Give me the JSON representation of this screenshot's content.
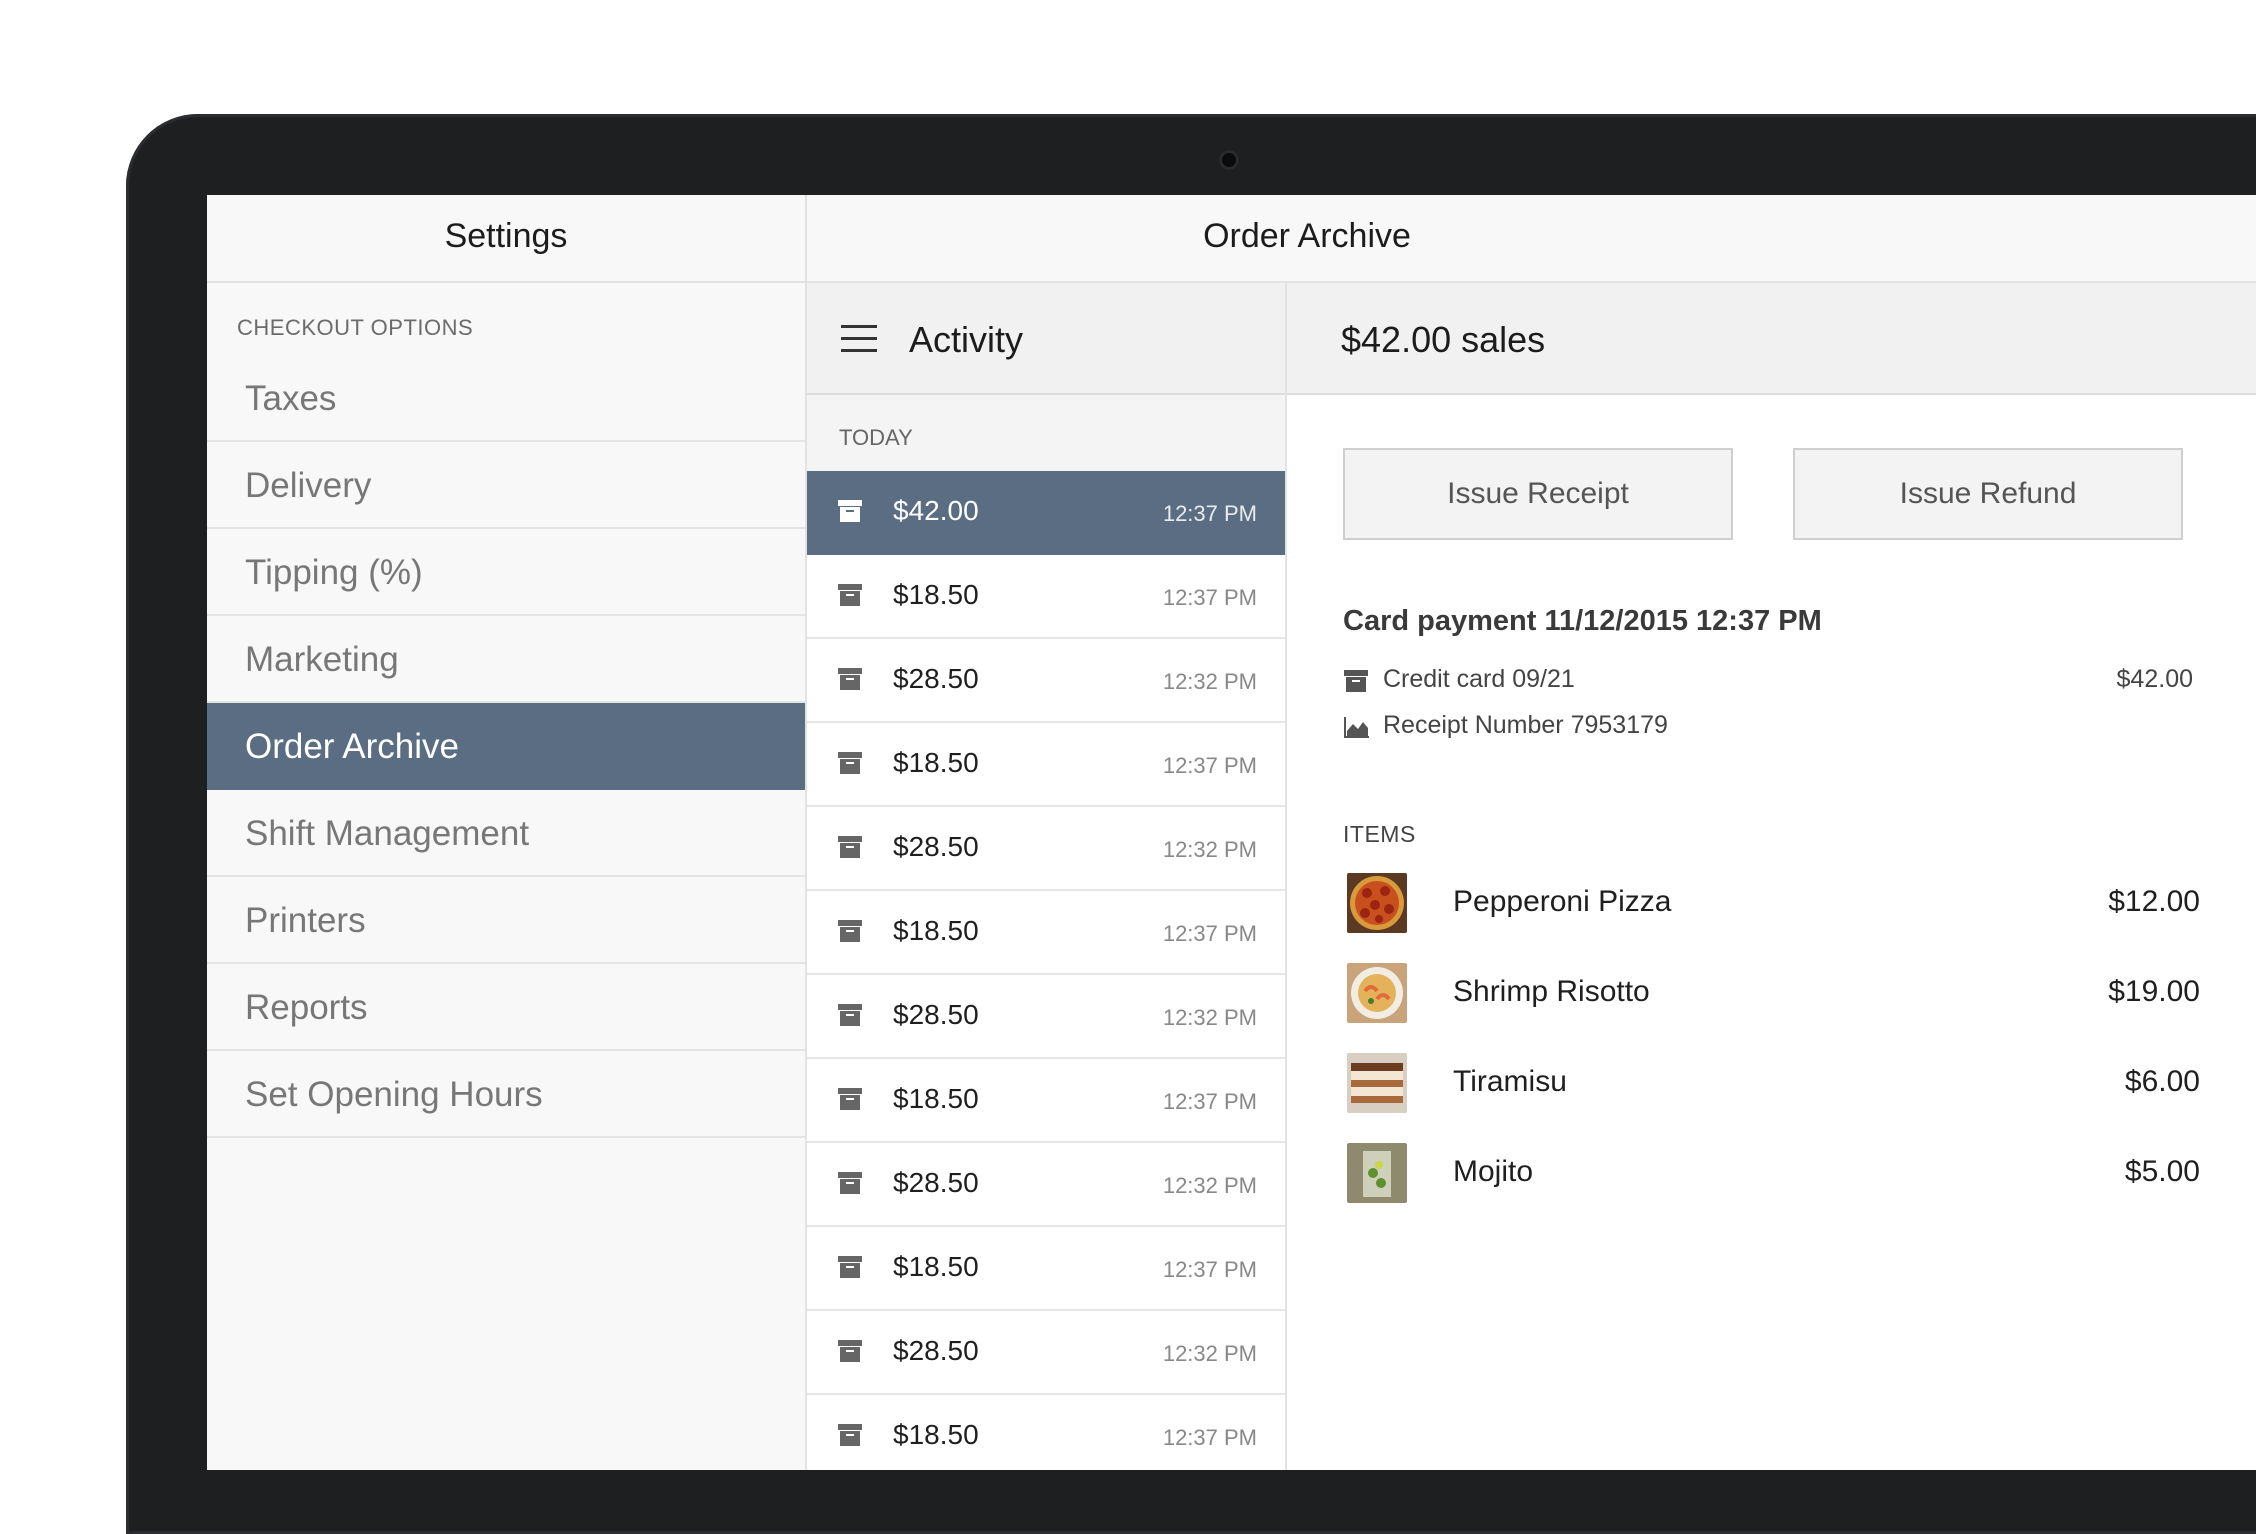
{
  "appbar": {
    "left_title": "Settings",
    "right_title": "Order Archive"
  },
  "sidebar": {
    "section_label": "CHECKOUT OPTIONS",
    "items": [
      {
        "label": "Taxes"
      },
      {
        "label": "Delivery"
      },
      {
        "label": "Tipping (%)"
      },
      {
        "label": "Marketing"
      },
      {
        "label": "Order Archive",
        "active": true
      },
      {
        "label": "Shift Management"
      },
      {
        "label": "Printers"
      },
      {
        "label": "Reports"
      },
      {
        "label": "Set Opening Hours"
      }
    ]
  },
  "activity": {
    "title": "Activity",
    "day_label": "TODAY",
    "orders": [
      {
        "amount": "$42.00",
        "time": "12:37 PM",
        "active": true
      },
      {
        "amount": "$18.50",
        "time": "12:37 PM"
      },
      {
        "amount": "$28.50",
        "time": "12:32 PM"
      },
      {
        "amount": "$18.50",
        "time": "12:37 PM"
      },
      {
        "amount": "$28.50",
        "time": "12:32 PM"
      },
      {
        "amount": "$18.50",
        "time": "12:37 PM"
      },
      {
        "amount": "$28.50",
        "time": "12:32 PM"
      },
      {
        "amount": "$18.50",
        "time": "12:37 PM"
      },
      {
        "amount": "$28.50",
        "time": "12:32 PM"
      },
      {
        "amount": "$18.50",
        "time": "12:37 PM"
      },
      {
        "amount": "$28.50",
        "time": "12:32 PM"
      },
      {
        "amount": "$18.50",
        "time": "12:37 PM"
      }
    ]
  },
  "detail": {
    "title": "$42.00 sales",
    "issue_receipt_label": "Issue Receipt",
    "issue_refund_label": "Issue Refund",
    "payment_title": "Card payment 11/12/2015 12:37 PM",
    "card_label": "Credit card 09/21",
    "card_amount": "$42.00",
    "receipt_label": "Receipt Number 7953179",
    "items_label": "ITEMS",
    "items": [
      {
        "name": "Pepperoni Pizza",
        "price": "$12.00",
        "thumb": "pizza"
      },
      {
        "name": "Shrimp Risotto",
        "price": "$19.00",
        "thumb": "risotto"
      },
      {
        "name": "Tiramisu",
        "price": "$6.00",
        "thumb": "tiramisu"
      },
      {
        "name": "Mojito",
        "price": "$5.00",
        "thumb": "mojito"
      }
    ]
  },
  "colors": {
    "accent": "#5a6d83"
  }
}
